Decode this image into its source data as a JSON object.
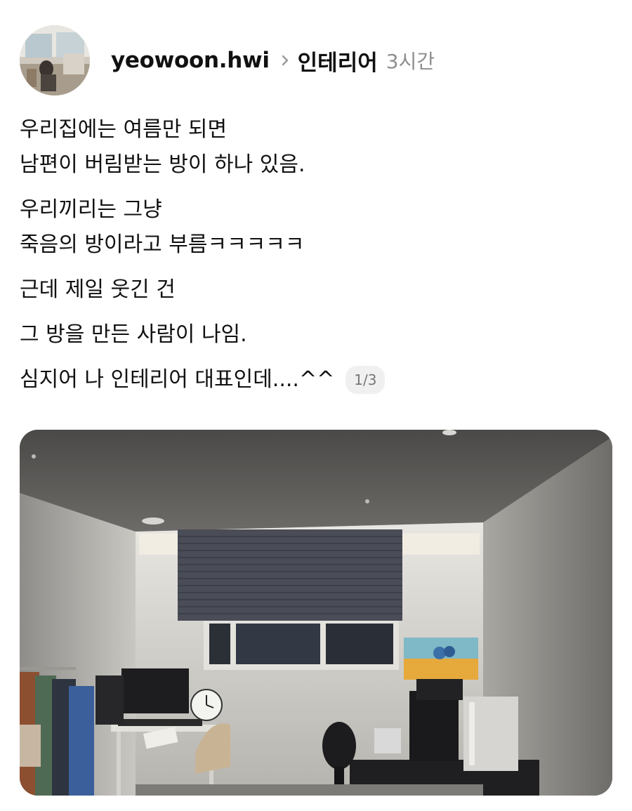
{
  "post": {
    "username": "yeowoon.hwi",
    "topic": "인테리어",
    "time": "3시간",
    "paragraphs": [
      [
        "우리집에는 여름만 되면",
        "남편이 버림받는 방이 하나 있음."
      ],
      [
        "우리끼리는 그냥",
        "죽음의 방이라고 부름ㅋㅋㅋㅋㅋ"
      ],
      [
        "근데 제일 웃긴 건"
      ],
      [
        "그 방을 만든 사람이 나임."
      ]
    ],
    "last_line": "심지어 나 인테리어 대표인데....^^",
    "image_counter": "1/3"
  },
  "icons": {
    "chevron": "chevron-right-icon"
  }
}
